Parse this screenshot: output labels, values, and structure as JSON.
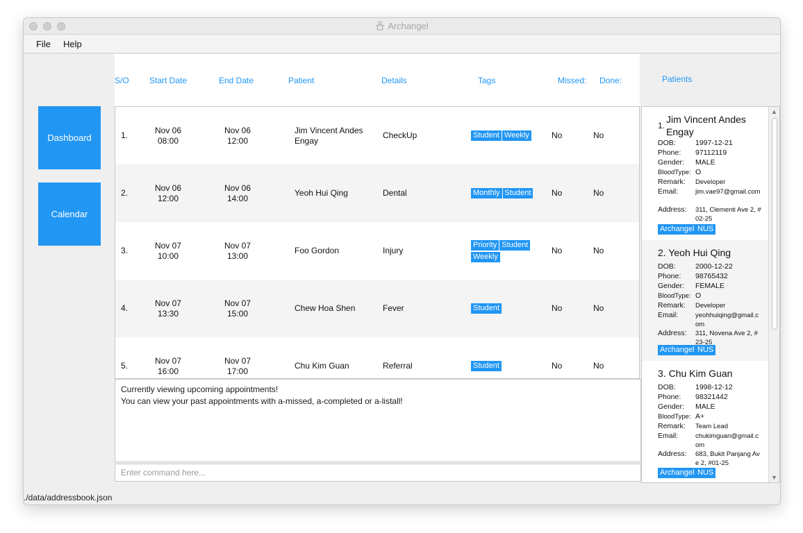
{
  "window": {
    "title": "Archangel"
  },
  "menu": {
    "file": "File",
    "help": "Help"
  },
  "sidebar": {
    "dashboard": "Dashboard",
    "calendar": "Calendar"
  },
  "appointments": {
    "headers": {
      "so": "S/O",
      "start": "Start Date",
      "end": "End Date",
      "patient": "Patient",
      "details": "Details",
      "tags": "Tags",
      "missed": "Missed:",
      "done": "Done:"
    },
    "rows": [
      {
        "so": "1.",
        "start_day": "Nov 06",
        "start_time": "08:00",
        "end_day": "Nov 06",
        "end_time": "12:00",
        "patient": "Jim Vincent Andes Engay",
        "details": "CheckUp",
        "tags": [
          "Student",
          "Weekly"
        ],
        "missed": "No",
        "done": "No"
      },
      {
        "so": "2.",
        "start_day": "Nov 06",
        "start_time": "12:00",
        "end_day": "Nov 06",
        "end_time": "14:00",
        "patient": "Yeoh Hui Qing",
        "details": "Dental",
        "tags": [
          "Monthly",
          "Student"
        ],
        "missed": "No",
        "done": "No"
      },
      {
        "so": "3.",
        "start_day": "Nov 07",
        "start_time": "10:00",
        "end_day": "Nov 07",
        "end_time": "13:00",
        "patient": "Foo Gordon",
        "details": "Injury",
        "tags": [
          "Priority",
          "Student",
          "Weekly"
        ],
        "missed": "No",
        "done": "No"
      },
      {
        "so": "4.",
        "start_day": "Nov 07",
        "start_time": "13:30",
        "end_day": "Nov 07",
        "end_time": "15:00",
        "patient": "Chew Hoa Shen",
        "details": "Fever",
        "tags": [
          "Student"
        ],
        "missed": "No",
        "done": "No"
      },
      {
        "so": "5.",
        "start_day": "Nov 07",
        "start_time": "16:00",
        "end_day": "Nov 07",
        "end_time": "17:00",
        "patient": "Chu Kim Guan",
        "details": "Referral",
        "tags": [
          "Student"
        ],
        "missed": "No",
        "done": "No"
      }
    ]
  },
  "result": {
    "line1": "Currently viewing upcoming appointments!",
    "line2": "You can view your past appointments with a-missed, a-completed or a-listall!"
  },
  "command": {
    "placeholder": "Enter command here..."
  },
  "status": {
    "path": "./data/addressbook.json"
  },
  "patients": {
    "header": "Patients",
    "labels": {
      "dob": "DOB:",
      "phone": "Phone:",
      "gender": "Gender:",
      "blood": "BloodType:",
      "remark": "Remark:",
      "email": "Email:",
      "address": "Address:"
    },
    "cards": [
      {
        "num": "1.",
        "name": "Jim Vincent Andes Engay",
        "dob": "1997-12-21",
        "phone": "97112119",
        "gender": "MALE",
        "blood": "O",
        "remark": "Developer",
        "email": "jim.vae97@gmail.com",
        "address": "311, Clementi Ave 2, #02-25",
        "tags": [
          "Archangel",
          "NUS"
        ]
      },
      {
        "num": "2.",
        "name": "Yeoh Hui Qing",
        "dob": "2000-12-22",
        "phone": "98765432",
        "gender": "FEMALE",
        "blood": "O",
        "remark": "Developer",
        "email": "yeohhuiqing@gmail.com",
        "address": "311, Novena Ave 2, #23-25",
        "tags": [
          "Archangel",
          "NUS"
        ]
      },
      {
        "num": "3.",
        "name": "Chu Kim Guan",
        "dob": "1998-12-12",
        "phone": "98321442",
        "gender": "MALE",
        "blood": "A+",
        "remark": "Team Lead",
        "email": "chukimguan@gmail.com",
        "address": "683, Bukit Panjang Ave 2, #01-25",
        "tags": [
          "Archangel",
          "NUS"
        ]
      }
    ]
  },
  "colors": {
    "accent": "#2196f3"
  }
}
